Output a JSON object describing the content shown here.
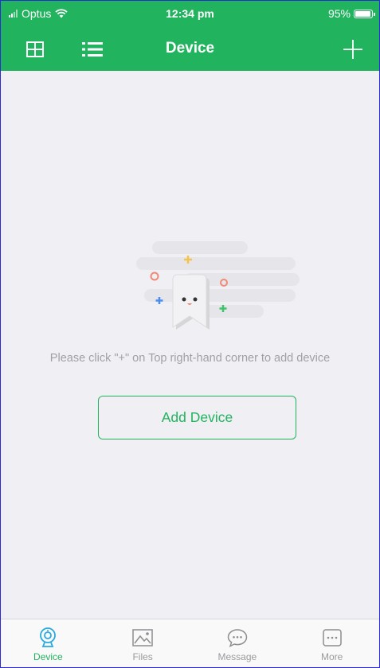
{
  "status_bar": {
    "carrier": "Optus",
    "time": "12:34 pm",
    "battery": "95%",
    "battery_level": 0.95
  },
  "nav": {
    "title": "Device"
  },
  "empty_state": {
    "hint": "Please click \"+\" on Top right-hand corner to add device",
    "button_label": "Add Device"
  },
  "tabs": [
    {
      "label": "Device",
      "icon": "camera-icon",
      "active": true
    },
    {
      "label": "Files",
      "icon": "image-icon",
      "active": false
    },
    {
      "label": "Message",
      "icon": "chat-bubble-icon",
      "active": false
    },
    {
      "label": "More",
      "icon": "more-dots-icon",
      "active": false
    }
  ],
  "colors": {
    "brand_green": "#22b35e",
    "active_tab_icon": "#29a9e0",
    "background": "#efeff4"
  }
}
